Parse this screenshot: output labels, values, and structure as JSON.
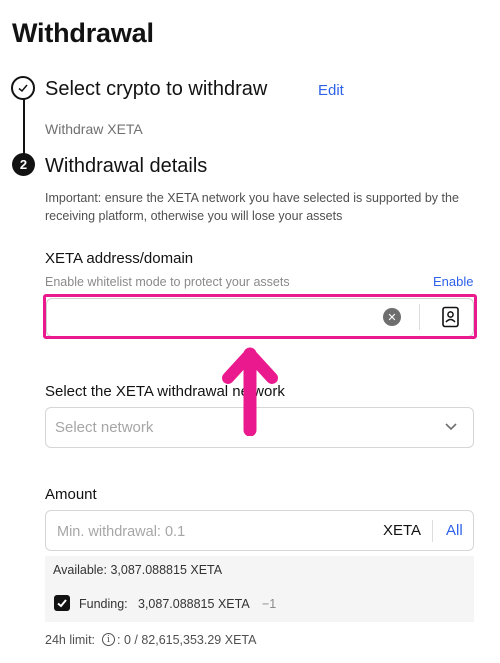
{
  "page": {
    "title": "Withdrawal"
  },
  "steps": {
    "step1": {
      "title": "Select crypto to withdraw",
      "edit_label": "Edit",
      "subtitle": "Withdraw XETA"
    },
    "step2": {
      "number": "2",
      "title": "Withdrawal details"
    }
  },
  "important_note": "Important: ensure the XETA network you have selected is supported by the receiving platform, otherwise you will lose your assets",
  "address": {
    "label": "XETA address/domain",
    "whitelist_hint": "Enable whitelist mode to protect your assets",
    "enable_label": "Enable",
    "value": "",
    "clear_icon": "clear-x-circle",
    "address_book_icon": "address-book"
  },
  "network": {
    "label": "Select the XETA withdrawal network",
    "placeholder": "Select network",
    "icon": "chevron-down"
  },
  "amount": {
    "label": "Amount",
    "placeholder": "Min. withdrawal: 0.1",
    "unit": "XETA",
    "all_label": "All",
    "available": "Available: 3,087.088815 XETA",
    "funding_label": "Funding:",
    "funding_value": "3,087.088815 XETA",
    "funding_delta": "−1",
    "funding_checked": true
  },
  "limit": {
    "label": "24h limit:",
    "value": ": 0 / 82,615,353.29 XETA"
  },
  "colors": {
    "accent": "#2d63e8",
    "highlight": "#ea1a8e",
    "text": "#121212"
  }
}
